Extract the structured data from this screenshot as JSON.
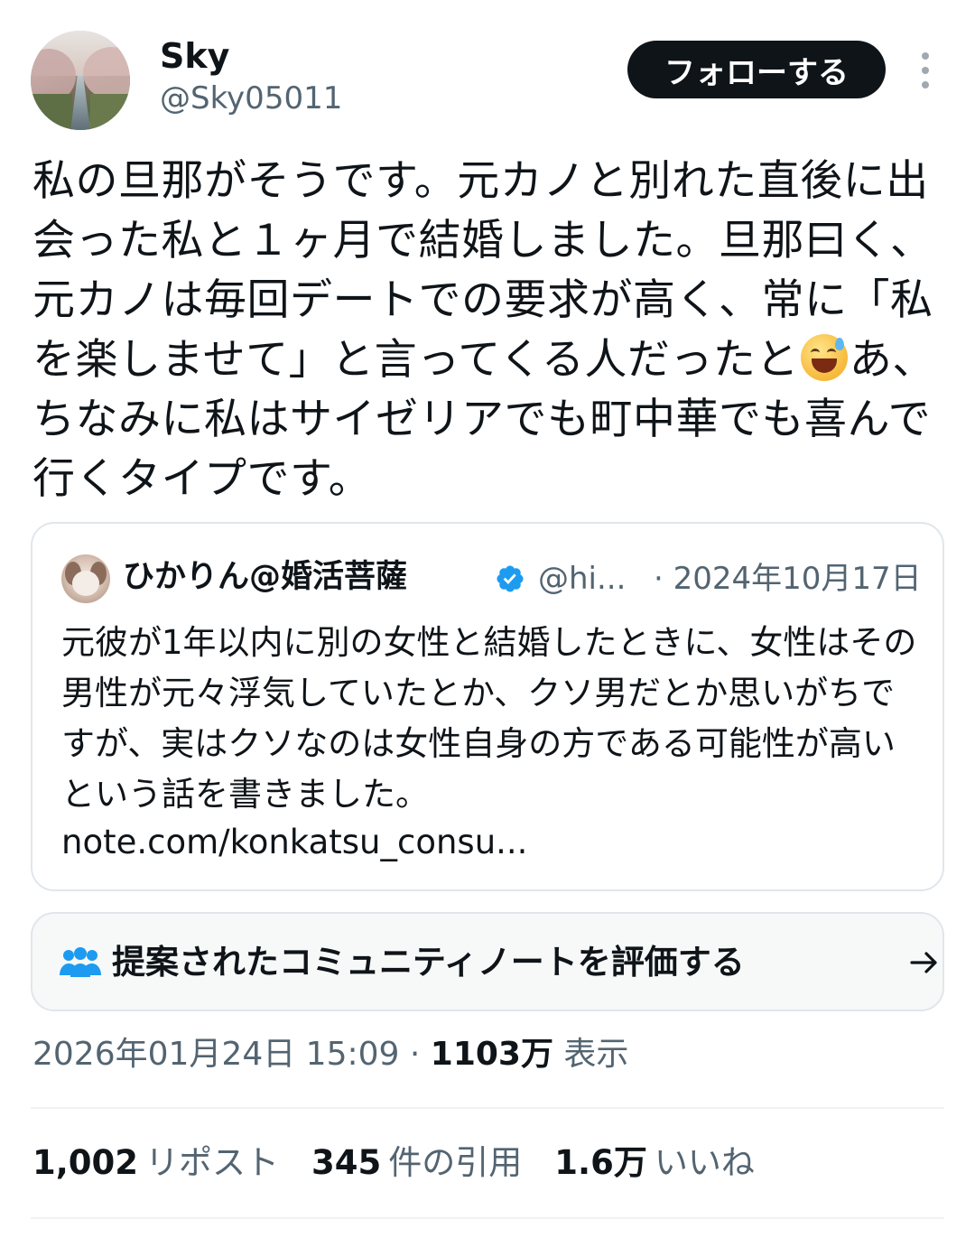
{
  "author": {
    "display_name": "Sky",
    "handle": "@Sky05011"
  },
  "follow_button": {
    "label": "フォローする"
  },
  "tweet": {
    "text_before_emoji": "私の旦那がそうです。元カノと別れた直後に出会った私と１ヶ月で結婚しました。旦那曰く、元カノは毎回デートでの要求が高く、常に「私を楽しませて」と言ってくる人だったと",
    "emoji": "sweat-smile-emoji",
    "text_after_emoji": "あ、ちなみに私はサイゼリアでも町中華でも喜んで行くタイプです。"
  },
  "quote": {
    "author_name": "ひかりん@婚活菩薩",
    "author_handle": "@hi...",
    "date": "· 2024年10月17日",
    "text": "元彼が1年以内に別の女性と結婚したときに、女性はその男性が元々浮気していたとか、クソ男だとか思いがちですが、実はクソなのは女性自身の方である可能性が高いという話を書きました。",
    "link": "note.com/konkatsu_consu..."
  },
  "community_note": {
    "label": "提案されたコミュニティノートを評価する"
  },
  "meta": {
    "timestamp": "2026年01月24日 15:09 · ",
    "views_count": "1103万",
    "views_label": " 表示"
  },
  "stats": {
    "reposts_count": "1,002",
    "reposts_label": "リポスト",
    "quotes_count": "345",
    "quotes_label": "件の引用",
    "likes_count": "1.6万",
    "likes_label": "いいね"
  },
  "colors": {
    "text_primary": "#0f1419",
    "text_secondary": "#536471",
    "verified": "#1d9bf0",
    "border": "#e1e6ea"
  }
}
